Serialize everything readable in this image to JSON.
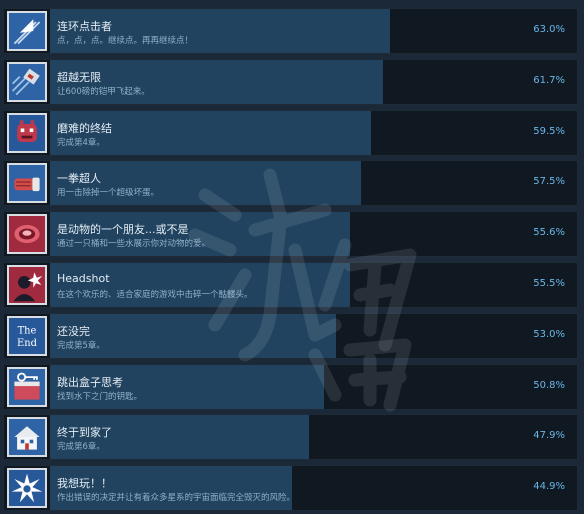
{
  "achievements": [
    {
      "title": "连环点击者",
      "description": "点，点，点。继续点。再再继续点！",
      "percent": "63.0%",
      "percent_value": 63.0,
      "icon": "cursor-icon",
      "icon_bg": "#2e63a6"
    },
    {
      "title": "超越无限",
      "description": "让600磅的铠甲飞起来。",
      "percent": "61.7%",
      "percent_value": 61.7,
      "icon": "flying-armor-icon",
      "icon_bg": "#2e63a6"
    },
    {
      "title": "磨难的终结",
      "description": "完成第4章。",
      "percent": "59.5%",
      "percent_value": 59.5,
      "icon": "dragon-face-icon",
      "icon_bg": "#27589a"
    },
    {
      "title": "一拳超人",
      "description": "用一击除掉一个超级坏蛋。",
      "percent": "57.5%",
      "percent_value": 57.5,
      "icon": "punch-icon",
      "icon_bg": "#2e63a6"
    },
    {
      "title": "是动物的一个朋友...或不是",
      "description": "通过一只桶和一些水展示你对动物的爱。",
      "percent": "55.6%",
      "percent_value": 55.6,
      "icon": "red-barrel-icon",
      "icon_bg": "#a02a3e"
    },
    {
      "title": "Headshot",
      "description": "在这个欢乐的、适合家庭的游戏中击碎一个骷髅头。",
      "percent": "55.5%",
      "percent_value": 55.5,
      "icon": "headshot-icon",
      "icon_bg": "#a02a3e"
    },
    {
      "title": "还没完",
      "description": "完成第5章。",
      "percent": "53.0%",
      "percent_value": 53.0,
      "icon": "the-end-icon",
      "icon_bg": "#27589a"
    },
    {
      "title": "跳出盒子思考",
      "description": "找到水下之门的钥匙。",
      "percent": "50.8%",
      "percent_value": 50.8,
      "icon": "key-box-icon",
      "icon_bg": "#2e63a6"
    },
    {
      "title": "终于到家了",
      "description": "完成第6章。",
      "percent": "47.9%",
      "percent_value": 47.9,
      "icon": "house-icon",
      "icon_bg": "#2e63a6"
    },
    {
      "title": "我想玩！！",
      "description": "作出错误的决定并让有着众多星系的宇宙面临完全毁灭的风险。",
      "percent": "44.9%",
      "percent_value": 44.9,
      "icon": "explosion-icon",
      "icon_bg": "#27589a"
    }
  ]
}
